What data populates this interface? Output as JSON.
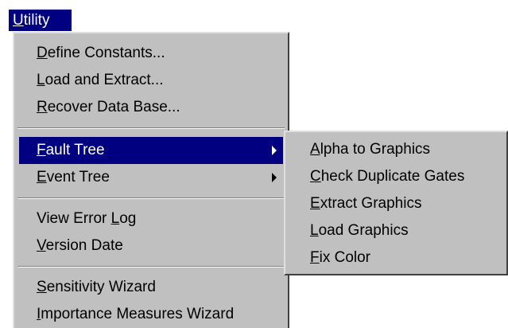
{
  "menubar": {
    "utility": {
      "pre": "",
      "key": "U",
      "post": "tility"
    }
  },
  "main_menu": {
    "items": [
      {
        "pre": "",
        "key": "D",
        "post": "efine Constants..."
      },
      {
        "pre": "",
        "key": "L",
        "post": "oad and Extract..."
      },
      {
        "pre": "",
        "key": "R",
        "post": "ecover Data Base..."
      },
      {
        "pre": "",
        "key": "F",
        "post": "ault Tree"
      },
      {
        "pre": "",
        "key": "E",
        "post": "vent Tree"
      },
      {
        "pre": "View Error ",
        "key": "L",
        "post": "og"
      },
      {
        "pre": "",
        "key": "V",
        "post": "ersion Date"
      },
      {
        "pre": "",
        "key": "S",
        "post": "ensitivity Wizard"
      },
      {
        "pre": "",
        "key": "I",
        "post": "mportance Measures Wizard"
      }
    ]
  },
  "fault_tree_submenu": {
    "items": [
      {
        "pre": "",
        "key": "A",
        "post": "lpha to Graphics"
      },
      {
        "pre": "",
        "key": "C",
        "post": "heck Duplicate Gates"
      },
      {
        "pre": "",
        "key": "E",
        "post": "xtract Graphics"
      },
      {
        "pre": "",
        "key": "L",
        "post": "oad Graphics"
      },
      {
        "pre": "",
        "key": "F",
        "post": "ix Color"
      }
    ]
  },
  "colors": {
    "menu_background": "#c0c0c0",
    "highlight": "#000080",
    "highlight_text": "#ffffff"
  }
}
